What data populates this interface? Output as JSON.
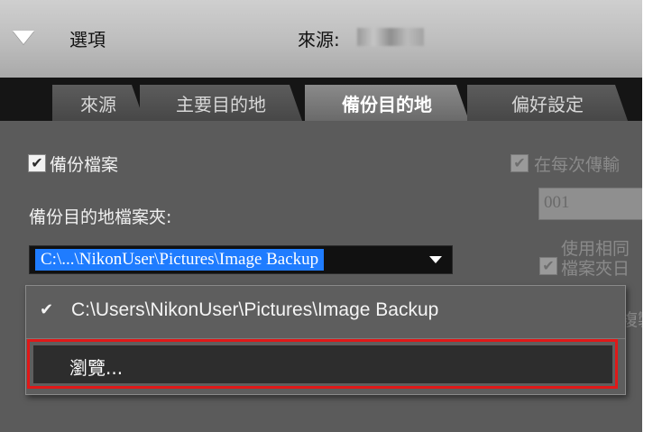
{
  "header": {
    "title": "選項",
    "source_label": "來源:"
  },
  "tabs": [
    {
      "label": "來源",
      "active": false
    },
    {
      "label": "主要目的地",
      "active": false
    },
    {
      "label": "備份目的地",
      "active": true
    },
    {
      "label": "偏好設定",
      "active": false
    }
  ],
  "options": {
    "backup_files_label": "備份檔案",
    "backup_files_checked": true,
    "each_transfer_label": "在每次傳輸",
    "each_transfer_checked": true,
    "backup_folder_label": "備份目的地檔案夾:",
    "folder_value": "C:\\...\\NikonUser\\Pictures\\Image Backup",
    "number_value": "001",
    "use_same_label_line1": "使用相同",
    "use_same_label_line2": "檔案夾日",
    "use_same_checked": true,
    "copy_label": "複製"
  },
  "dropdown": {
    "selected_item": "C:\\Users\\NikonUser\\Pictures\\Image Backup",
    "browse_label": "瀏覽..."
  },
  "colors": {
    "highlight_border": "#e01818",
    "selection": "#1f7cff"
  }
}
